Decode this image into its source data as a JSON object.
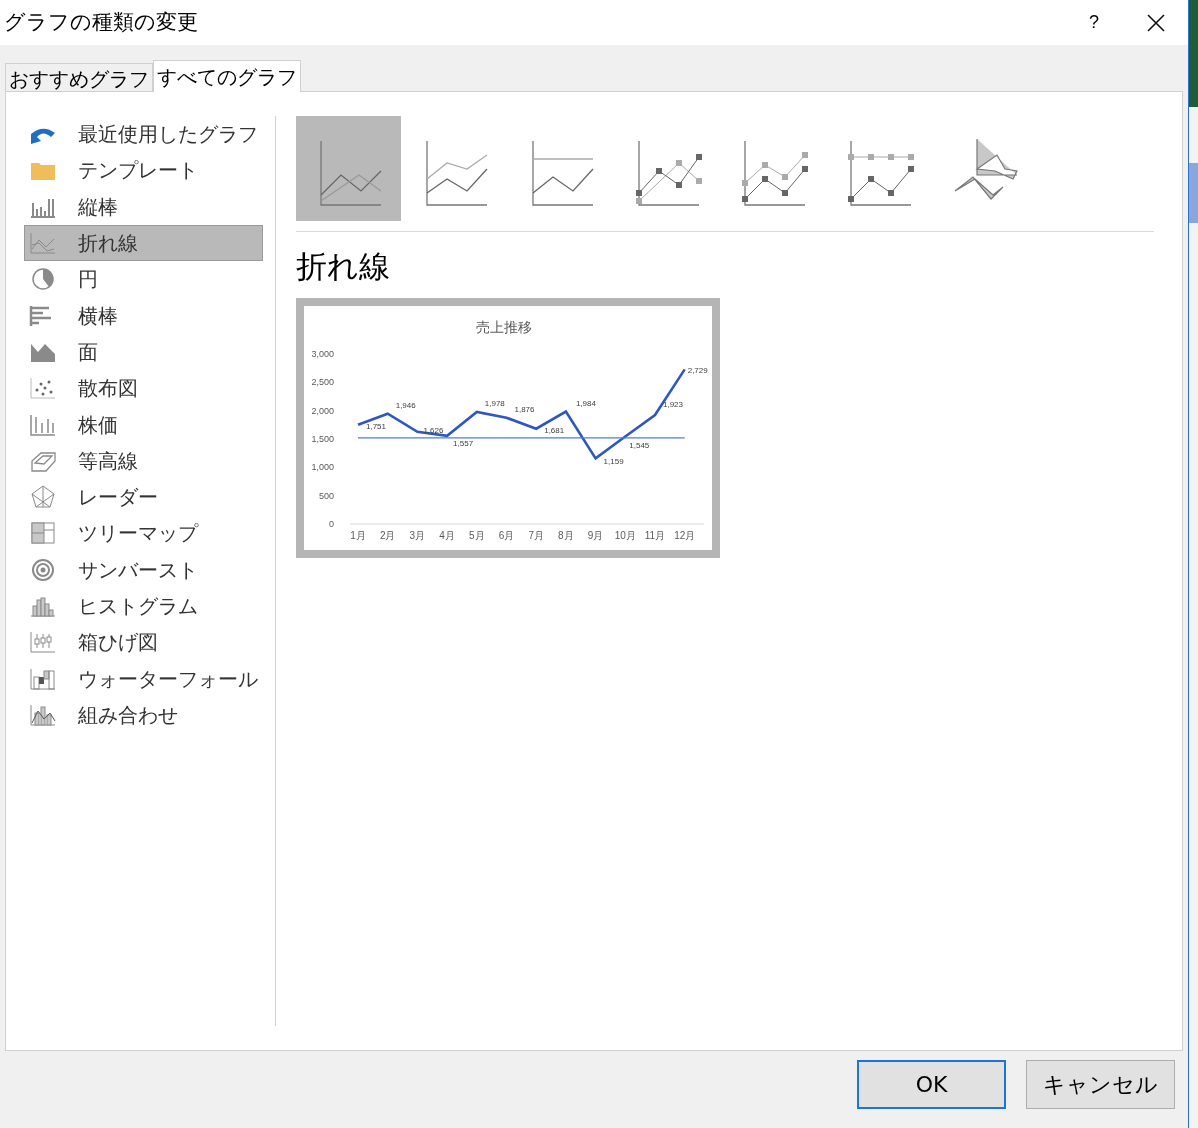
{
  "window": {
    "title": "グラフの種類の変更",
    "help": "?"
  },
  "tabs": [
    {
      "label": "おすすめグラフ",
      "selected": false
    },
    {
      "label": "すべてのグラフ",
      "selected": true
    }
  ],
  "sidebar": {
    "items": [
      {
        "label": "最近使用したグラフ",
        "selected": false
      },
      {
        "label": "テンプレート",
        "selected": false
      },
      {
        "label": "縦棒",
        "selected": false
      },
      {
        "label": "折れ線",
        "selected": true
      },
      {
        "label": "円",
        "selected": false
      },
      {
        "label": "横棒",
        "selected": false
      },
      {
        "label": "面",
        "selected": false
      },
      {
        "label": "散布図",
        "selected": false
      },
      {
        "label": "株価",
        "selected": false
      },
      {
        "label": "等高線",
        "selected": false
      },
      {
        "label": "レーダー",
        "selected": false
      },
      {
        "label": "ツリーマップ",
        "selected": false
      },
      {
        "label": "サンバースト",
        "selected": false
      },
      {
        "label": "ヒストグラム",
        "selected": false
      },
      {
        "label": "箱ひげ図",
        "selected": false
      },
      {
        "label": "ウォーターフォール",
        "selected": false
      },
      {
        "label": "組み合わせ",
        "selected": false
      }
    ]
  },
  "subtypes": [
    {
      "selected": true
    },
    {
      "selected": false
    },
    {
      "selected": false
    },
    {
      "selected": false
    },
    {
      "selected": false
    },
    {
      "selected": false
    },
    {
      "selected": false
    }
  ],
  "preview": {
    "heading": "折れ線",
    "chart_data": {
      "type": "line",
      "title": "売上推移",
      "categories": [
        "1月",
        "2月",
        "3月",
        "4月",
        "5月",
        "6月",
        "7月",
        "8月",
        "9月",
        "10月",
        "11月",
        "12月"
      ],
      "series": [
        {
          "color": "#2e58c0",
          "values": [
            1751,
            1946,
            1626,
            1557,
            1978,
            1876,
            1681,
            1984,
            1159,
            1545,
            1923,
            2729
          ]
        },
        {
          "color": "#4a7fd8",
          "values": [
            1520,
            1520,
            1520,
            1520,
            1520,
            1520,
            1520,
            1520,
            1520,
            1520,
            1520,
            1520
          ]
        }
      ],
      "value_labels": [
        "1,751",
        "1,946",
        "1,626",
        "1,557",
        "1,978",
        "1,876",
        "1,681",
        "1,984",
        "1,159",
        "1,545",
        "1,923",
        "2,729"
      ],
      "ylim": [
        0,
        3000
      ],
      "yticks": [
        {
          "value": 0,
          "label": "0"
        },
        {
          "value": 500,
          "label": "500"
        },
        {
          "value": 1000,
          "label": "1,000"
        },
        {
          "value": 1500,
          "label": "1,500"
        },
        {
          "value": 2000,
          "label": "2,000"
        },
        {
          "value": 2500,
          "label": "2,500"
        },
        {
          "value": 3000,
          "label": "3,000"
        }
      ]
    }
  },
  "buttons": [
    {
      "label": "OK",
      "kind": "default"
    },
    {
      "label": "キャンセル",
      "kind": "normal"
    }
  ]
}
